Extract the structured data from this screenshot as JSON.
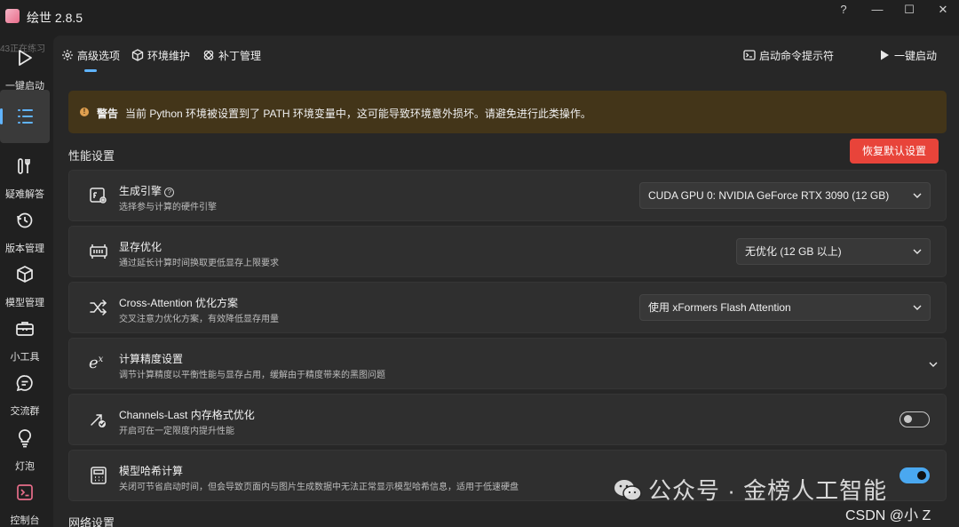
{
  "app": {
    "title": "绘世 2.8.5"
  },
  "window_controls": {
    "help": "?",
    "minimize": "—",
    "maximize": "☐",
    "close": "✕"
  },
  "overlay_text": "43正在练习",
  "sidebar": {
    "items": [
      {
        "label": "一键启动",
        "icon": "play-icon"
      },
      {
        "label": "",
        "icon": "list-icon",
        "active": true
      },
      {
        "label": "疑难解答",
        "icon": "tools-icon"
      },
      {
        "label": "版本管理",
        "icon": "history-icon"
      },
      {
        "label": "模型管理",
        "icon": "cube-icon"
      },
      {
        "label": "小工具",
        "icon": "toolbox-icon"
      },
      {
        "label": "交流群",
        "icon": "chat-icon"
      },
      {
        "label": "灯泡",
        "icon": "lightbulb-icon"
      },
      {
        "label": "控制台",
        "icon": "console-icon"
      }
    ]
  },
  "tabs": [
    {
      "label": "高级选项",
      "icon": "gear-icon",
      "active": true
    },
    {
      "label": "环境维护",
      "icon": "package-icon"
    },
    {
      "label": "补丁管理",
      "icon": "patch-icon"
    }
  ],
  "header_actions": {
    "cmd_prompt": "启动命令提示符",
    "launch": "一键启动"
  },
  "warning": {
    "title": "警告",
    "text": "当前 Python 环境被设置到了 PATH 环境变量中，这可能导致环境意外损坏。请避免进行此类操作。",
    "color": "#433519"
  },
  "performance": {
    "section_title": "性能设置",
    "reset_button": "恢复默认设置",
    "reset_color": "#e8443a",
    "settings": [
      {
        "title": "生成引擎",
        "subtitle": "选择参与计算的硬件引擎",
        "control": "select",
        "value": "CUDA GPU 0: NVIDIA GeForce RTX 3090 (12 GB)",
        "icon": "engine-icon",
        "has_help": true
      },
      {
        "title": "显存优化",
        "subtitle": "通过延长计算时间换取更低显存上限要求",
        "control": "select",
        "value": "无优化 (12 GB 以上)",
        "icon": "memory-chip-icon"
      },
      {
        "title": "Cross-Attention 优化方案",
        "subtitle": "交叉注意力优化方案，有效降低显存用量",
        "control": "select",
        "value": "使用 xFormers Flash Attention",
        "icon": "shuffle-icon"
      },
      {
        "title": "计算精度设置",
        "subtitle": "调节计算精度以平衡性能与显存占用，缓解由于精度带来的黑图问题",
        "control": "expand",
        "icon": "exponent-icon"
      },
      {
        "title": "Channels-Last 内存格式优化",
        "subtitle": "开启可在一定限度内提升性能",
        "control": "toggle",
        "value": false,
        "icon": "arrow-check-icon"
      },
      {
        "title": "模型哈希计算",
        "subtitle": "关闭可节省启动时间，但会导致页面内与图片生成数据中无法正常显示模型哈希信息，适用于低速硬盘",
        "control": "toggle",
        "value": true,
        "icon": "calculator-icon"
      }
    ]
  },
  "network": {
    "section_title": "网络设置"
  },
  "watermarks": {
    "wechat": "公众号 · 金榜人工智能",
    "csdn": "CSDN @小 Z"
  }
}
